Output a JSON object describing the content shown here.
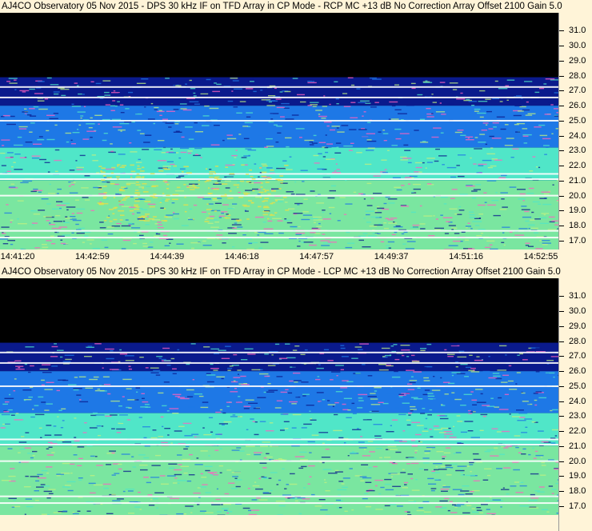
{
  "chart_data": [
    {
      "type": "heatmap",
      "title": "AJ4CO Observatory 05 Nov 2015 - DPS 30 kHz IF on TFD Array in CP Mode - RCP  MC +13 dB  No Correction Array  Offset 2100  Gain 5.0",
      "y_ticks": [
        "31.0",
        "30.0",
        "29.0",
        "28.0",
        "27.0",
        "26.0",
        "25.0",
        "24.0",
        "23.0",
        "22.0",
        "21.0",
        "20.0",
        "19.0",
        "18.0",
        "17.0"
      ],
      "x_ticks": [
        "14:41:20",
        "14:42:59",
        "14:44:39",
        "14:46:18",
        "14:47:57",
        "14:49:37",
        "14:51:16",
        "14:52:55"
      ],
      "ylim": [
        16.4,
        32.2
      ],
      "colors": {
        "background": "#000000",
        "low": "#0a1a8c",
        "mid": "#1e78e6",
        "high": "#50e6c8",
        "peak": "#f0e040"
      }
    },
    {
      "type": "heatmap",
      "title": "AJ4CO Observatory 05 Nov 2015 - DPS 30 kHz IF on TFD Array in CP Mode - LCP  MC +13 dB  No Correction Array  Offset 2100  Gain 5.0",
      "y_ticks": [
        "31.0",
        "30.0",
        "29.0",
        "28.0",
        "27.0",
        "26.0",
        "25.0",
        "24.0",
        "23.0",
        "22.0",
        "21.0",
        "20.0",
        "19.0",
        "18.0",
        "17.0"
      ],
      "x_ticks": [],
      "ylim": [
        16.4,
        32.2
      ],
      "colors": {
        "background": "#000000",
        "low": "#0a1a8c",
        "mid": "#1e78e6",
        "high": "#50e6c8",
        "peak": "#f0e040"
      }
    }
  ]
}
